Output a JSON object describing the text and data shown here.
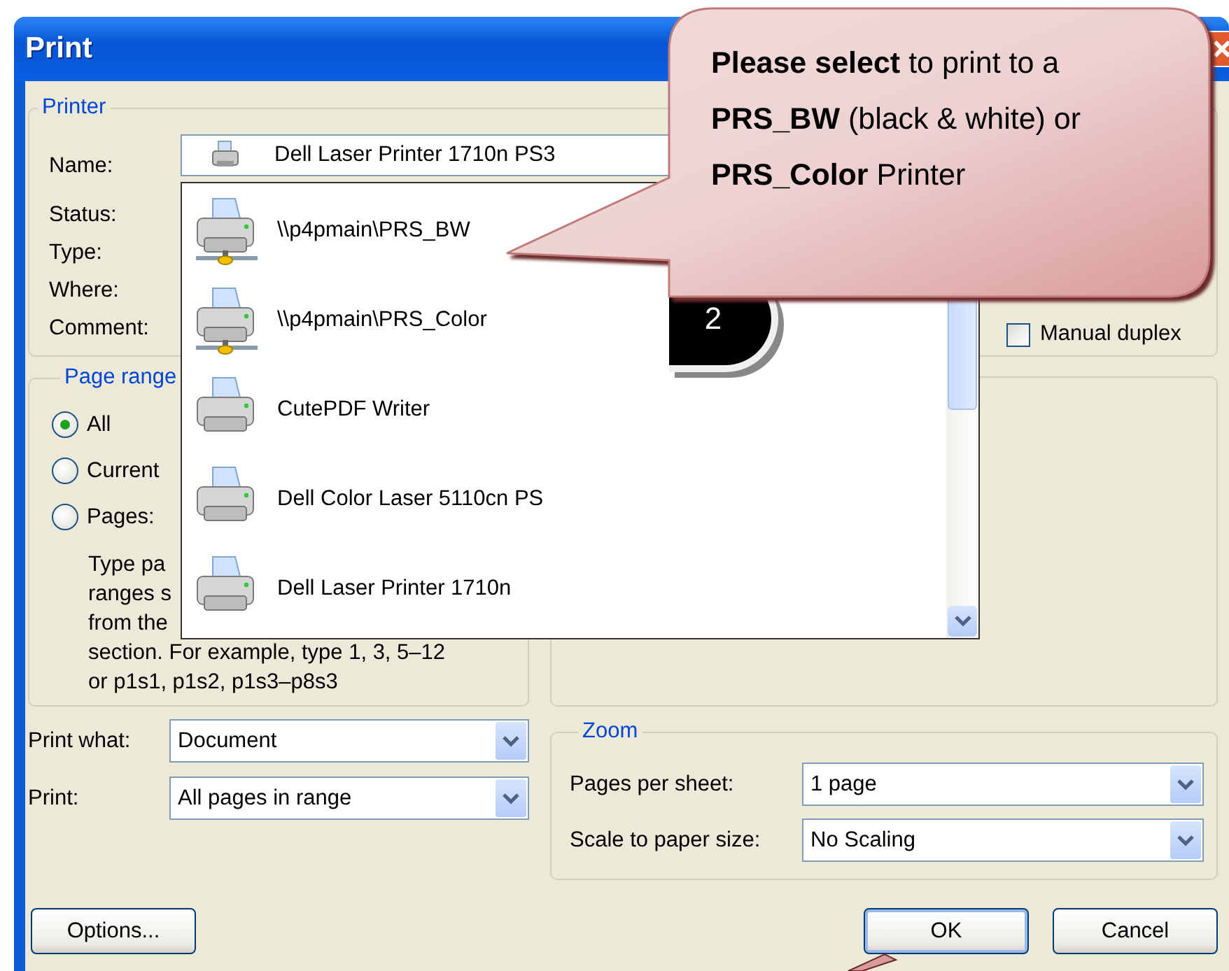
{
  "window": {
    "title": "Print"
  },
  "printer": {
    "legend": "Printer",
    "labels": [
      "Name:",
      "Status:",
      "Type:",
      "Where:",
      "Comment:"
    ],
    "name_value": "Dell Laser Printer 1710n PS3",
    "manual_duplex": {
      "label": "Manual duplex",
      "checked": false
    }
  },
  "printer_list": [
    {
      "name": "\\\\p4pmain\\PRS_BW",
      "kind": "network"
    },
    {
      "name": "\\\\p4pmain\\PRS_Color",
      "kind": "network"
    },
    {
      "name": "CutePDF Writer",
      "kind": "local"
    },
    {
      "name": "Dell Color Laser 5110cn PS",
      "kind": "local"
    },
    {
      "name": "Dell Laser Printer 1710n",
      "kind": "local"
    }
  ],
  "page_range": {
    "legend": "Page range",
    "options": [
      {
        "label": "All",
        "selected": true
      },
      {
        "label": "Current",
        "selected": false
      },
      {
        "label": "Pages:",
        "selected": false
      }
    ],
    "hint_lines": [
      "Type pa",
      "ranges s",
      "from the",
      "section. For example, type 1, 3, 5–12",
      "or p1s1, p1s2, p1s3–p8s3"
    ]
  },
  "print_what": {
    "label": "Print what:",
    "value": "Document"
  },
  "print": {
    "label": "Print:",
    "value": "All pages in range"
  },
  "zoom": {
    "legend": "Zoom",
    "rows": [
      {
        "label": "Pages per sheet:",
        "value": "1 page"
      },
      {
        "label": "Scale to paper size:",
        "value": "No Scaling"
      }
    ]
  },
  "buttons": {
    "options": "Options...",
    "ok": "OK",
    "cancel": "Cancel"
  },
  "callout": {
    "text": "**Please select** to print to a **PRS_BW** (black & white) or **PRS_Color** Printer",
    "step": "2"
  }
}
